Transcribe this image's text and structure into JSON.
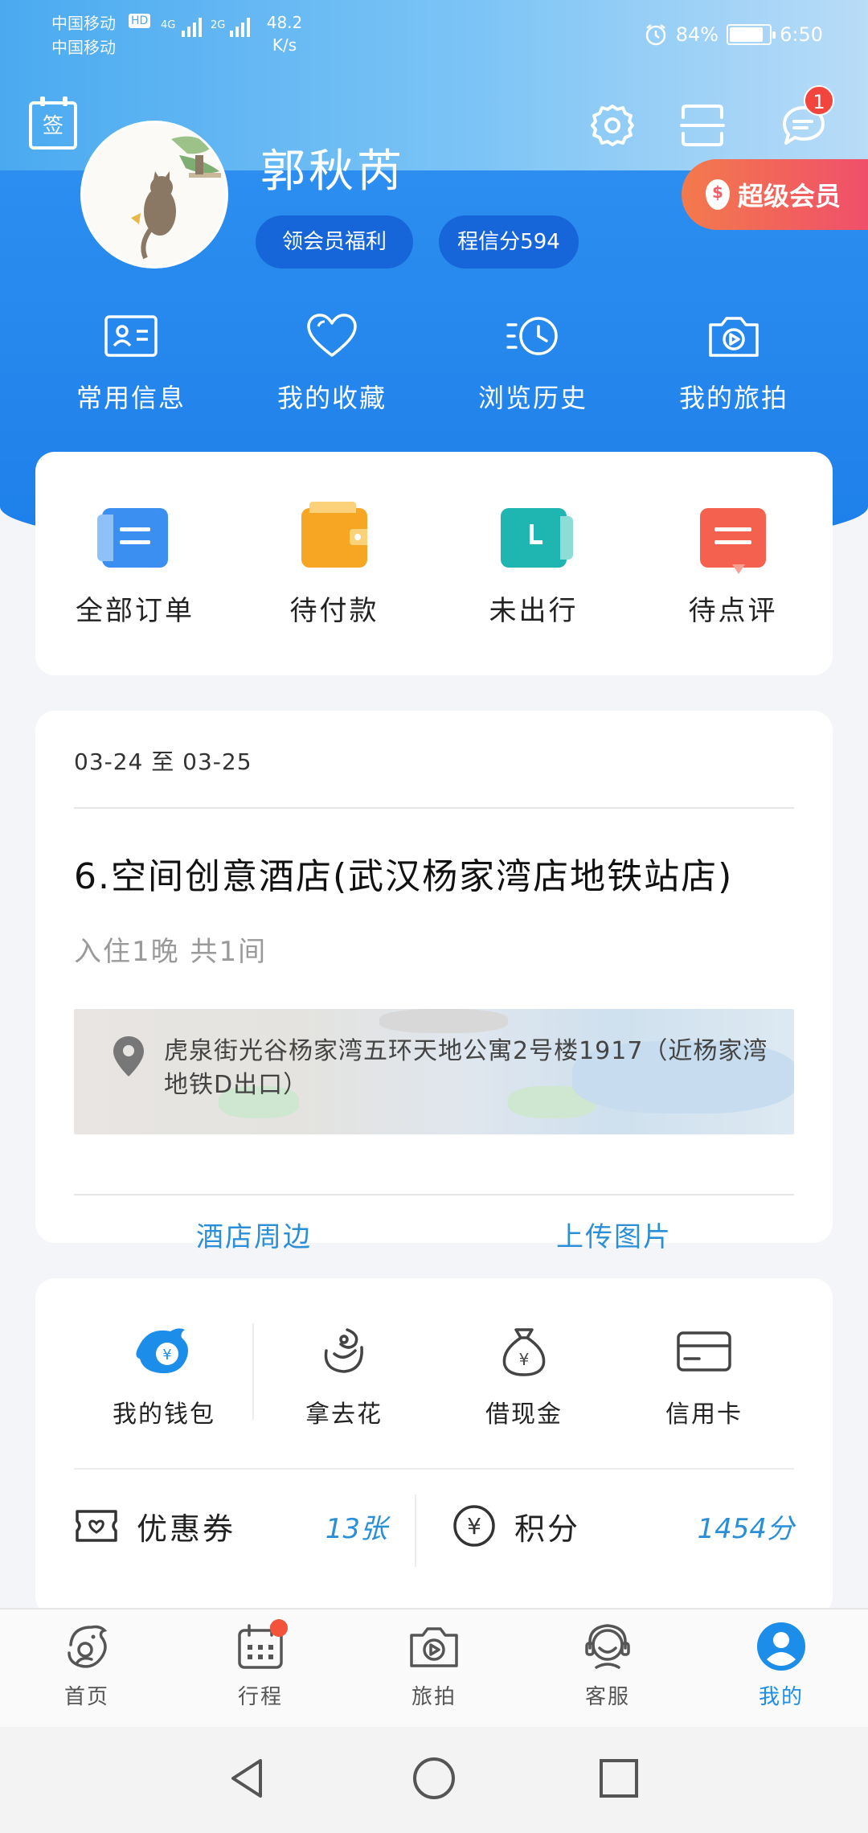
{
  "status_bar": {
    "carrier1": "中国移动",
    "carrier2": "中国移动",
    "hd": "HD",
    "net1": "4G",
    "net2": "2G",
    "speed_value": "48.2",
    "speed_unit": "K/s",
    "battery": "84%",
    "time": "6:50"
  },
  "header": {
    "sign_label": "签",
    "notification_count": "1",
    "username": "郭秋芮",
    "benefits_pill": "领会员福利",
    "credit_pill": "程信分594",
    "vip_label": "超级会员",
    "vip_icon_glyph": "$"
  },
  "quick_links": [
    {
      "label": "常用信息",
      "icon": "id-card-icon"
    },
    {
      "label": "我的收藏",
      "icon": "heart-icon"
    },
    {
      "label": "浏览历史",
      "icon": "history-clock-icon"
    },
    {
      "label": "我的旅拍",
      "icon": "camera-icon"
    }
  ],
  "orders": [
    {
      "label": "全部订单",
      "color": "#3b8ff0"
    },
    {
      "label": "待付款",
      "color": "#f6a623"
    },
    {
      "label": "未出行",
      "color": "#1fb5b0"
    },
    {
      "label": "待点评",
      "color": "#f4624f"
    }
  ],
  "hotel_card": {
    "dates": "03-24 至 03-25",
    "name": "6.空间创意酒店(武汉杨家湾店地铁站店)",
    "stay": "入住1晚 共1间",
    "address": "虎泉街光谷杨家湾五环天地公寓2号楼1917（近杨家湾地铁D出口）",
    "link_nearby": "酒店周边",
    "link_upload": "上传图片"
  },
  "finance": {
    "items": [
      {
        "label": "我的钱包",
        "icon": "wallet-dolphin-icon"
      },
      {
        "label": "拿去花",
        "icon": "credit-spend-icon"
      },
      {
        "label": "借现金",
        "icon": "money-bag-icon"
      },
      {
        "label": "信用卡",
        "icon": "credit-card-icon"
      }
    ],
    "coupon_label": "优惠券",
    "coupon_value": "13张",
    "points_label": "积分",
    "points_value": "1454分",
    "yen_glyph": "¥"
  },
  "tabbar": [
    {
      "label": "首页",
      "icon": "home-dolphin-icon"
    },
    {
      "label": "行程",
      "icon": "calendar-icon"
    },
    {
      "label": "旅拍",
      "icon": "camera-play-icon"
    },
    {
      "label": "客服",
      "icon": "headset-icon"
    },
    {
      "label": "我的",
      "icon": "profile-icon"
    }
  ],
  "colors": {
    "brand_blue": "#1c8de9",
    "link_blue": "#2a8fd6",
    "badge_red": "#f2453d"
  }
}
